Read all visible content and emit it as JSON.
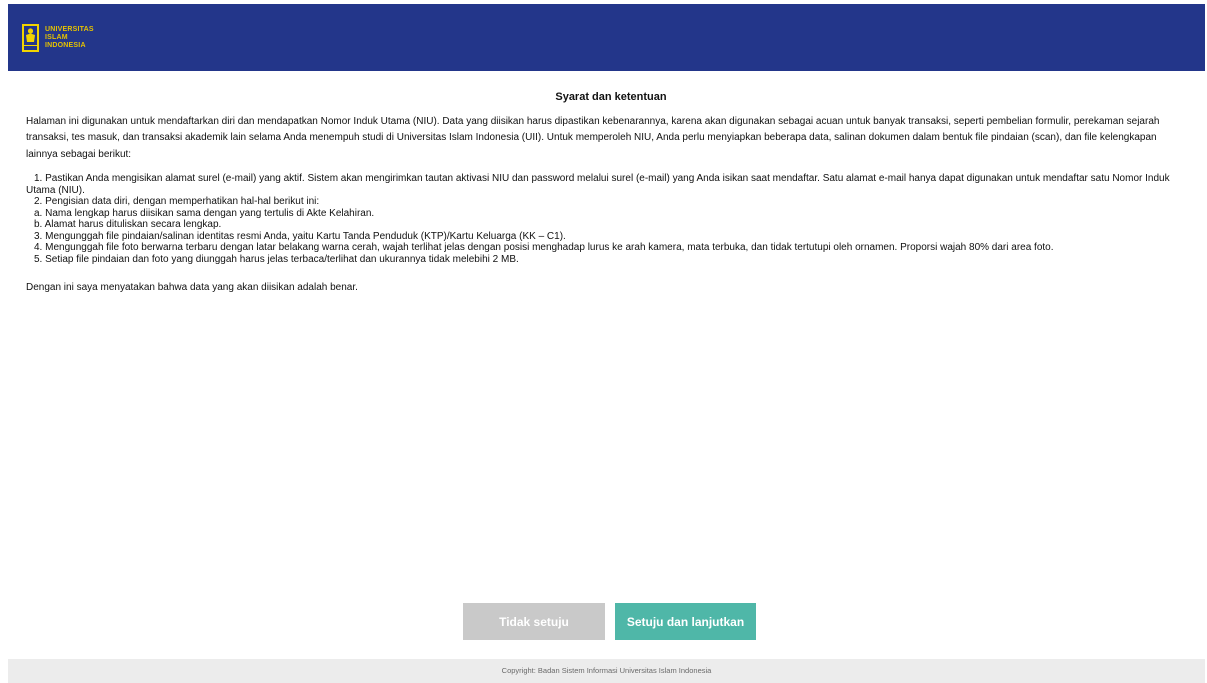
{
  "colors": {
    "header_bg": "#23368a",
    "logo_text": "#e6c200",
    "button_disagree_bg": "#c9c9c9",
    "button_agree_bg": "#4fb7a8",
    "footer_bg": "#ececec"
  },
  "header": {
    "logo_icon": "university-crest-icon",
    "logo_lines": [
      "UNIVERSITAS",
      "ISLAM",
      "INDONESIA"
    ]
  },
  "terms": {
    "title": "Syarat dan ketentuan",
    "intro": [
      "Halaman ini digunakan untuk mendaftarkan diri dan mendapatkan Nomor Induk Utama (NIU). Data yang diisikan harus dipastikan kebenarannya, karena akan digunakan sebagai acuan untuk banyak transaksi, seperti pembelian formulir, perekaman sejarah",
      "transaksi, tes masuk, dan transaksi akademik lain selama Anda menempuh studi di Universitas Islam Indonesia (UII). Untuk memperoleh NIU, Anda perlu menyiapkan beberapa data, salinan dokumen dalam bentuk file pindaian (scan), dan file kelengkapan",
      "lainnya sebagai berikut:"
    ],
    "rules": [
      "1. Pastikan Anda mengisikan alamat surel (e-mail) yang aktif. Sistem akan mengirimkan tautan aktivasi NIU dan password melalui surel (e-mail) yang Anda isikan saat mendaftar. Satu alamat e-mail hanya dapat digunakan untuk mendaftar satu Nomor Induk Utama (NIU).",
      "2. Pengisian data diri, dengan memperhatikan hal-hal berikut ini:",
      "a. Nama lengkap harus diisikan sama dengan yang tertulis di Akte Kelahiran.",
      "b. Alamat harus dituliskan secara lengkap.",
      "3. Mengunggah file pindaian/salinan identitas resmi Anda, yaitu Kartu Tanda Penduduk (KTP)/Kartu Keluarga (KK – C1).",
      "4. Mengunggah file foto berwarna terbaru dengan latar belakang warna cerah, wajah terlihat jelas dengan posisi menghadap lurus ke arah kamera, mata terbuka, dan tidak tertutupi oleh ornamen. Proporsi wajah 80% dari area foto.",
      "5. Setiap file pindaian dan foto yang diunggah harus jelas terbaca/terlihat dan ukurannya tidak melebihi 2 MB."
    ],
    "statement": "Dengan ini saya menyatakan bahwa data yang akan diisikan adalah benar."
  },
  "actions": {
    "disagree_label": "Tidak setuju",
    "agree_label": "Setuju dan lanjutkan"
  },
  "footer": {
    "copyright": "Copyright: Badan Sistem Informasi Universitas Islam Indonesia"
  }
}
